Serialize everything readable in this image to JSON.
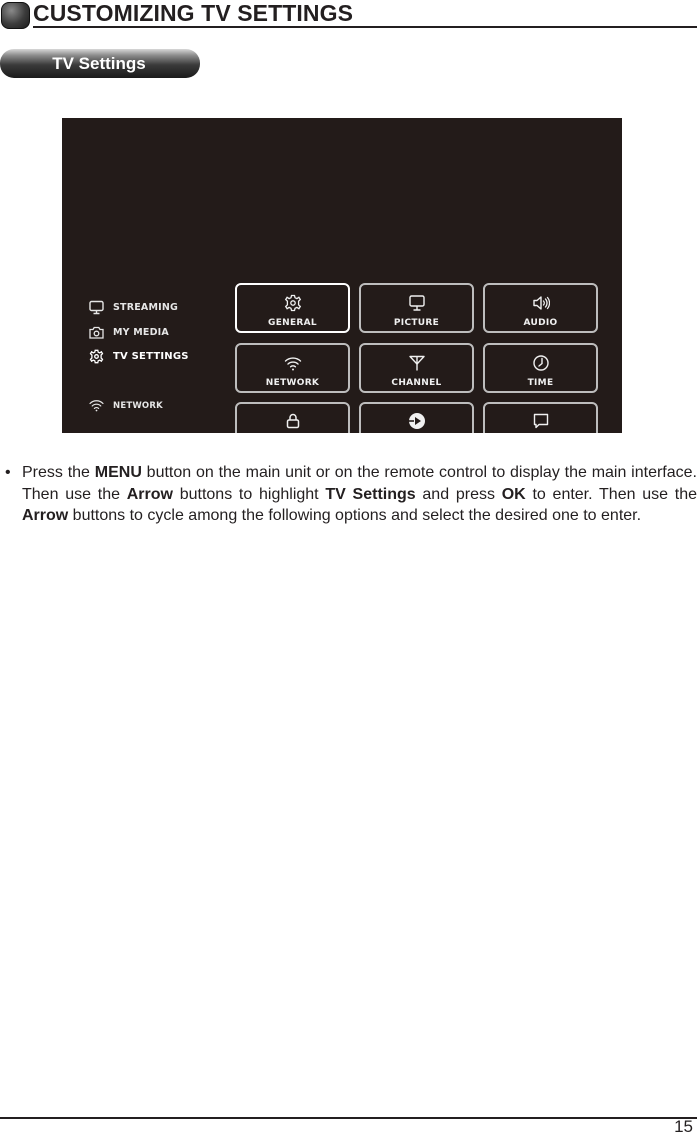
{
  "header": {
    "title": "CUSTOMIZING TV SETTINGS",
    "section_label": "TV Settings"
  },
  "tv_screen": {
    "sidebar": [
      {
        "label": "STREAMING",
        "icon": "monitor-icon",
        "active": false
      },
      {
        "label": "MY MEDIA",
        "icon": "camera-icon",
        "active": false
      },
      {
        "label": "TV SETTINGS",
        "icon": "gear-icon",
        "active": true
      },
      {
        "label": "NETWORK",
        "icon": "wifi-icon",
        "active": false
      }
    ],
    "tiles": [
      {
        "label": "GENERAL",
        "icon": "gear-icon",
        "focused": true
      },
      {
        "label": "PICTURE",
        "icon": "monitor-icon",
        "focused": false
      },
      {
        "label": "AUDIO",
        "icon": "speaker-icon",
        "focused": false
      },
      {
        "label": "NETWORK",
        "icon": "wifi-icon",
        "focused": false
      },
      {
        "label": "CHANNEL",
        "icon": "antenna-icon",
        "focused": false
      },
      {
        "label": "TIME",
        "icon": "clock-icon",
        "focused": false
      },
      {
        "label": "",
        "icon": "lock-icon",
        "focused": false
      },
      {
        "label": "",
        "icon": "play-circle-icon",
        "focused": false
      },
      {
        "label": "",
        "icon": "chat-bubble-icon",
        "focused": false
      }
    ]
  },
  "instructions": {
    "bullet": "•",
    "segments": [
      {
        "text": "Press the ",
        "bold": false
      },
      {
        "text": "MENU",
        "bold": true
      },
      {
        "text": " button on the main unit or on the remote control to display the main interface. Then use the ",
        "bold": false
      },
      {
        "text": "Arrow",
        "bold": true
      },
      {
        "text": " buttons to highlight ",
        "bold": false
      },
      {
        "text": "TV Settings",
        "bold": true
      },
      {
        "text": " and press ",
        "bold": false
      },
      {
        "text": "OK",
        "bold": true
      },
      {
        "text": " to enter. Then use the ",
        "bold": false
      },
      {
        "text": "Arrow",
        "bold": true
      },
      {
        "text": " buttons to cycle among the following options and select the desired one to enter.",
        "bold": false
      }
    ]
  },
  "footer": {
    "page_number": "15"
  }
}
